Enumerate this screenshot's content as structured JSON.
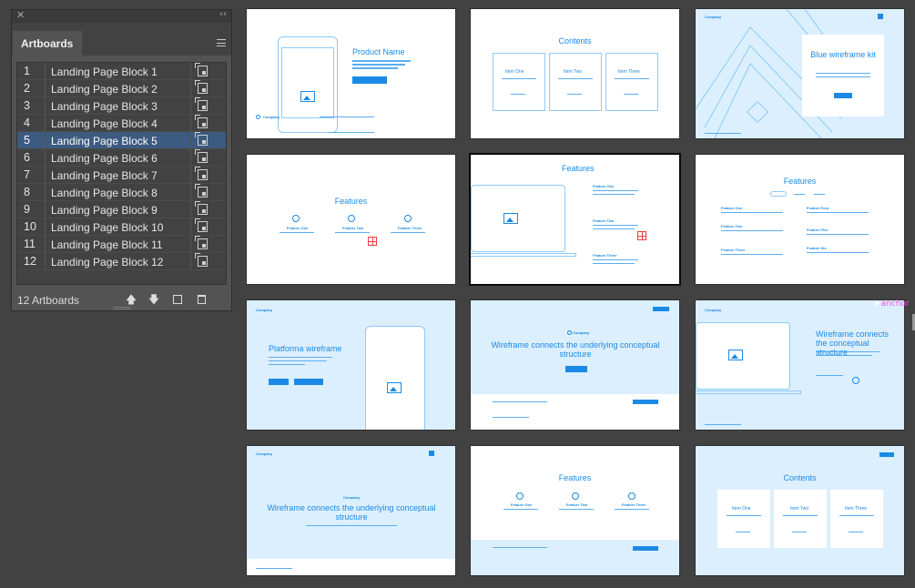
{
  "panel": {
    "title": "Artboards",
    "count_label": "12 Artboards",
    "selected_index": 4,
    "artboards": [
      {
        "num": "1",
        "name": "Landing Page Block 1"
      },
      {
        "num": "2",
        "name": "Landing Page Block 2"
      },
      {
        "num": "3",
        "name": "Landing Page Block 3"
      },
      {
        "num": "4",
        "name": "Landing Page Block 4"
      },
      {
        "num": "5",
        "name": "Landing Page Block 5"
      },
      {
        "num": "6",
        "name": "Landing Page Block 6"
      },
      {
        "num": "7",
        "name": "Landing Page Block 7"
      },
      {
        "num": "8",
        "name": "Landing Page Block 8"
      },
      {
        "num": "9",
        "name": "Landing Page Block 9"
      },
      {
        "num": "10",
        "name": "Landing Page Block 10"
      },
      {
        "num": "11",
        "name": "Landing Page Block 11"
      },
      {
        "num": "12",
        "name": "Landing Page Block 12"
      }
    ]
  },
  "thumbs": {
    "t1": {
      "title": "Product Name",
      "company": "Company"
    },
    "t2": {
      "title": "Contents",
      "item1": "Item One",
      "item2": "Item Two",
      "item3": "Item Three"
    },
    "t3": {
      "title": "Blue wireframe kit",
      "company": "Company"
    },
    "t4": {
      "title": "Features",
      "f1": "Feature One",
      "f2": "Feature Two",
      "f3": "Feature Three"
    },
    "t5": {
      "title": "Features",
      "f1": "Feature One",
      "f2": "Feature Two",
      "f3": "Feature Three"
    },
    "t6": {
      "title": "Features",
      "f1": "Feature One",
      "f2": "Feature Two",
      "f3": "Feature Three",
      "f4": "Feature Four",
      "f5": "Feature Five",
      "f6": "Feature Six"
    },
    "t7": {
      "title": "Platforma wireframe",
      "company": "Company"
    },
    "t8": {
      "title": "Wireframe connects the underlying conceptual structure",
      "company": "Company"
    },
    "t9": {
      "title": "Wireframe connects the conceptual structure",
      "company": "Company"
    },
    "t10": {
      "title": "Wireframe connects the underlying conceptual structure",
      "company": "Company"
    },
    "t11": {
      "title": "Features",
      "f1": "Feature One",
      "f2": "Feature Two",
      "f3": "Feature Three"
    },
    "t12": {
      "title": "Contents",
      "item1": "Item One",
      "item2": "Item Two",
      "item3": "Item Three"
    }
  },
  "cursor_label": "anchor",
  "colors": {
    "accent": "#1a8ae6",
    "selection": "#3d5a80",
    "canvas": "#424242",
    "panel": "#535353",
    "thumb_blue": "#dcefff"
  },
  "icons": {
    "close": "close-icon",
    "collapse": "collapse-icon",
    "menu": "panel-menu-icon",
    "artboard_options": "artboard-options-icon",
    "move_up": "arrow-up-icon",
    "move_down": "arrow-down-icon",
    "new": "new-artboard-icon",
    "delete": "trash-icon"
  }
}
